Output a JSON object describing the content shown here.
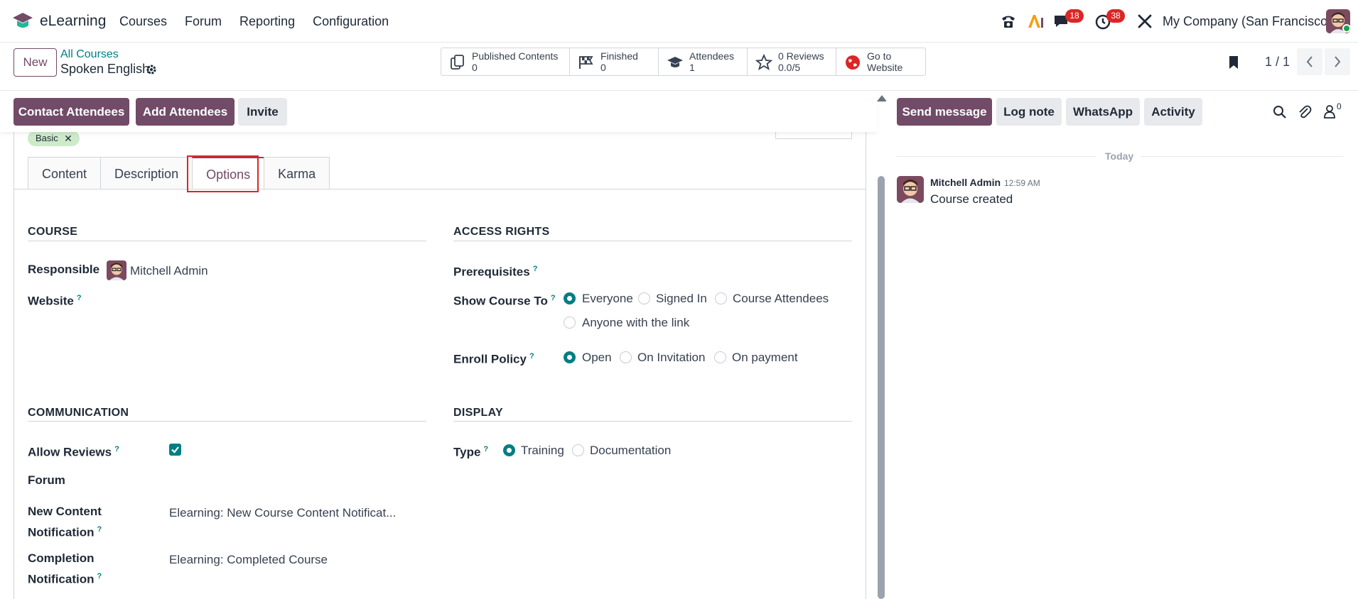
{
  "navbar": {
    "app_name": "eLearning",
    "menu": [
      "Courses",
      "Forum",
      "Reporting",
      "Configuration"
    ],
    "messages_count": "18",
    "activities_count": "38",
    "company": "My Company (San Francisco)",
    "icons": [
      "phone-icon",
      "ai-icon",
      "chat-icon",
      "clock-icon",
      "tools-icon",
      "user-avatar"
    ]
  },
  "control": {
    "new_label": "New",
    "breadcrumb_parent": "All Courses",
    "record_title": "Spoken English",
    "pager": "1 / 1",
    "smart_buttons": [
      {
        "label": "Published Contents",
        "value": "0",
        "icon": "docs-icon"
      },
      {
        "label": "Finished",
        "value": "0",
        "icon": "flag-icon"
      },
      {
        "label": "Attendees",
        "value": "1",
        "icon": "graduation-cap-icon"
      },
      {
        "label": "0 Reviews",
        "value": "0.0/5",
        "icon": "star-icon"
      },
      {
        "label": "Go to",
        "value": "Website",
        "icon": "globe-icon"
      }
    ]
  },
  "actions": {
    "contact_attendees": "Contact Attendees",
    "add_attendees": "Add Attendees",
    "invite": "Invite"
  },
  "form": {
    "tag": "Basic",
    "tabs": [
      "Content",
      "Description",
      "Options",
      "Karma"
    ],
    "active_tab": "Options",
    "course_section": "COURSE",
    "responsible_label": "Responsible",
    "responsible_value": "Mitchell Admin",
    "website_label": "Website",
    "access_section": "ACCESS RIGHTS",
    "prerequisites_label": "Prerequisites",
    "show_course_label": "Show Course To",
    "show_course_options": [
      "Everyone",
      "Signed In",
      "Course Attendees",
      "Anyone with the link"
    ],
    "show_course_selected": "Everyone",
    "enroll_label": "Enroll Policy",
    "enroll_options": [
      "Open",
      "On Invitation",
      "On payment"
    ],
    "enroll_selected": "Open",
    "communication_section": "COMMUNICATION",
    "allow_reviews_label": "Allow Reviews",
    "allow_reviews_checked": true,
    "forum_label": "Forum",
    "new_content_label_1": "New Content",
    "new_content_label_2": "Notification",
    "new_content_value": "Elearning: New Course Content Notificat...",
    "completion_label_1": "Completion",
    "completion_label_2": "Notification",
    "completion_value": "Elearning: Completed Course",
    "display_section": "DISPLAY",
    "type_label": "Type",
    "type_options": [
      "Training",
      "Documentation"
    ],
    "type_selected": "Training",
    "help_mark": "?"
  },
  "chatter": {
    "send_message": "Send message",
    "log_note": "Log note",
    "whatsapp": "WhatsApp",
    "activity": "Activity",
    "followers_count": "0",
    "date_separator": "Today",
    "message": {
      "author": "Mitchell Admin",
      "time": "12:59 AM",
      "body": "Course created"
    }
  },
  "colors": {
    "primary": "#714B67",
    "accent": "#017e84",
    "badge": "#dc2626",
    "tag": "#cdeac9",
    "highlight": "#dc2626"
  }
}
